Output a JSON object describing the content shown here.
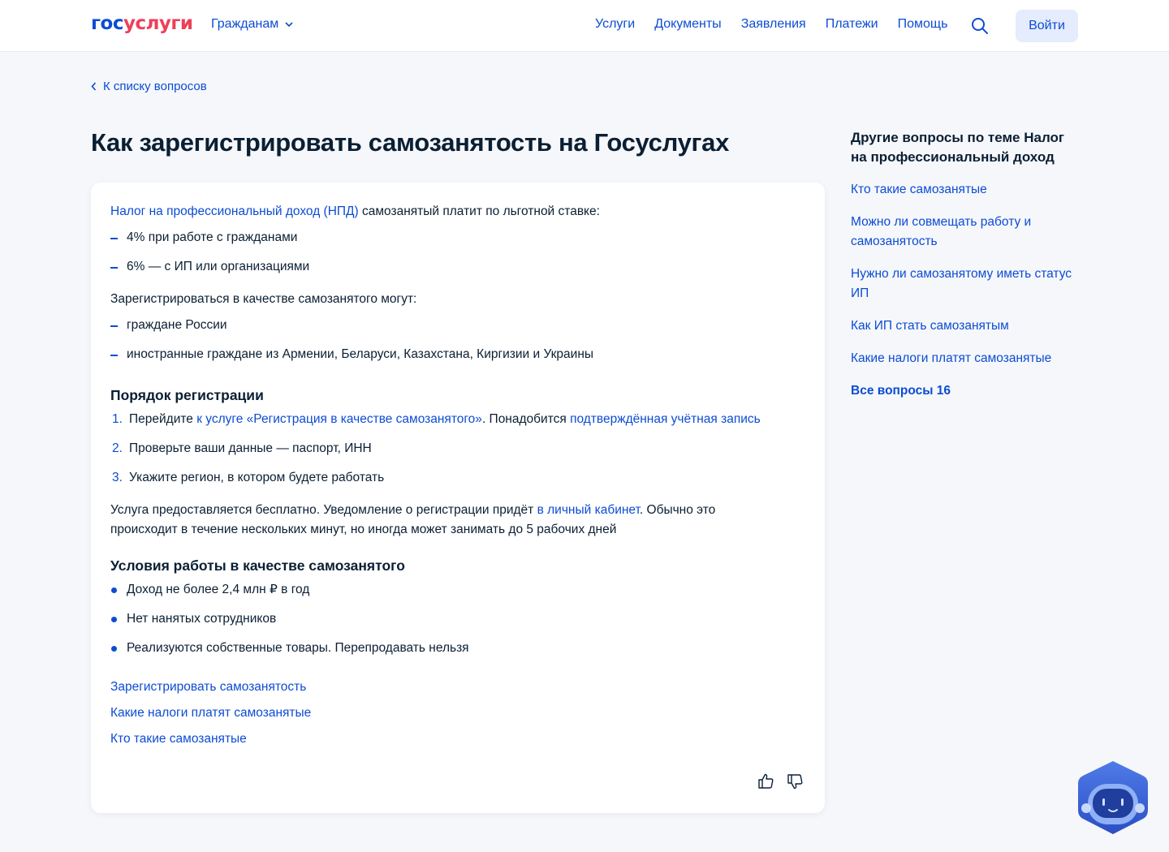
{
  "header": {
    "logo_part1": "гос",
    "logo_part2": "услуги",
    "audience": "Гражданам",
    "nav": [
      "Услуги",
      "Документы",
      "Заявления",
      "Платежи",
      "Помощь"
    ],
    "login": "Войти"
  },
  "back_link": "К списку вопросов",
  "title": "Как зарегистрировать самозанятость на Госуслугах",
  "article": {
    "intro_link": "Налог на профессиональный доход (НПД)",
    "intro_text": " самозанятый платит по льготной ставке:",
    "rates": [
      "4% при работе с гражданами",
      "6% — с ИП или организациями"
    ],
    "who_text": "Зарегистрироваться в качестве самозанятого могут:",
    "who": [
      "граждане России",
      "иностранные граждане из Армении, Беларуси, Казахстана, Киргизии и Украины"
    ],
    "order_heading": "Порядок регистрации",
    "steps": {
      "s1_num": "1.",
      "s1_text_a": "Перейдите ",
      "s1_link_a": "к услуге «Регистрация в качестве самозанятого»",
      "s1_text_b": ". Понадобится ",
      "s1_link_b": "подтверждённая учётная запись",
      "s2_num": "2.",
      "s2_text": "Проверьте ваши данные — паспорт, ИНН",
      "s3_num": "3.",
      "s3_text": "Укажите регион, в котором будете работать"
    },
    "free_text_a": "Услуга предоставляется бесплатно. Уведомление о регистрации придёт ",
    "free_link": "в личный кабинет",
    "free_text_b": ". Обычно это происходит в течение нескольких минут, но иногда может занимать до 5 рабочих дней",
    "conditions_heading": "Условия работы в качестве самозанятого",
    "conditions": [
      "Доход не более 2,4 млн ₽ в год",
      "Нет нанятых сотрудников",
      "Реализуются собственные товары. Перепродавать нельзя"
    ],
    "related": [
      "Зарегистрировать самозанятость",
      "Какие налоги платят самозанятые",
      "Кто такие самозанятые"
    ]
  },
  "aside": {
    "title": "Другие вопросы по теме Налог на профессиональный доход",
    "items": [
      "Кто такие самозанятые",
      "Можно ли совмещать работу и самозанятость",
      "Нужно ли самозанятому иметь статус ИП",
      "Как ИП стать самозанятым",
      "Какие налоги платят самозанятые"
    ],
    "all": "Все вопросы 16"
  },
  "icons": {
    "search": "search-icon",
    "chevron_down": "chevron-down-icon",
    "chevron_left": "chevron-left-icon",
    "like": "thumbs-up-icon",
    "dislike": "thumbs-down-icon",
    "assistant": "robot-assistant-icon"
  },
  "colors": {
    "brand_blue": "#0d4cd3",
    "brand_red": "#ee3f58",
    "text": "#0b1f33",
    "background": "#f5f7fb",
    "login_bg": "#e4ecfd"
  }
}
